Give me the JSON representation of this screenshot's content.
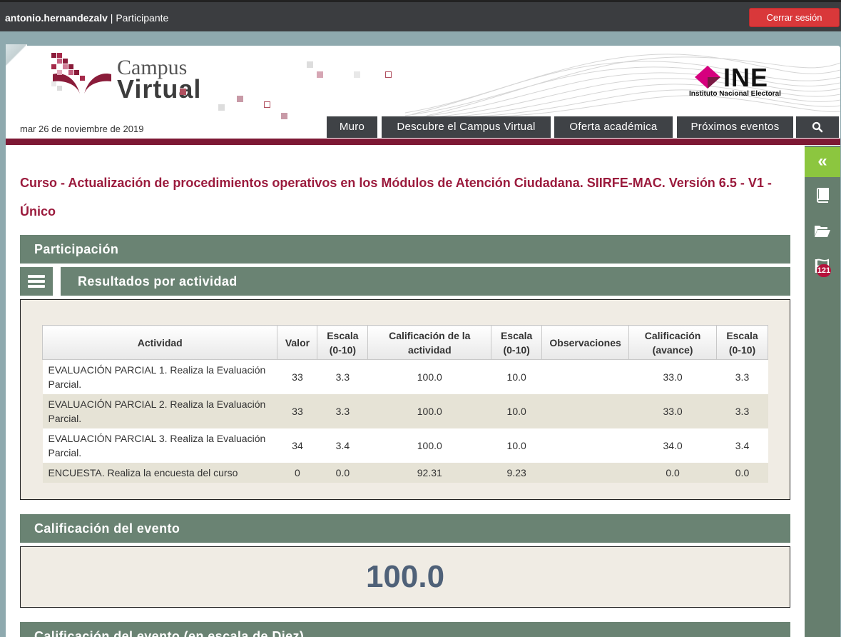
{
  "topbar": {
    "username": "antonio.hernandezalv",
    "separator": " | ",
    "role": "Participante",
    "logout_label": "Cerrar sesión"
  },
  "header": {
    "logo_line1": "Campus",
    "logo_line2": "Virtual",
    "ine_logo": "INE",
    "ine_subtitle": "Instituto Nacional Electoral",
    "date": "mar 26 de noviembre de 2019",
    "nav": [
      "Muro",
      "Descubre el Campus Virtual",
      "Oferta académica",
      "Próximos eventos"
    ],
    "search_icon": "search-icon"
  },
  "sidebar": {
    "toggle_label": "«",
    "icons": [
      "book-icon",
      "folder-open-icon",
      "flag-icon"
    ],
    "badge_count": "121"
  },
  "course": {
    "title": "Curso - Actualización de procedimientos operativos en los Módulos de Atención Ciudadana. SIIRFE-MAC. Versión 6.5 - V1 - Único"
  },
  "participation": {
    "heading": "Participación",
    "results_heading": "Resultados por actividad",
    "columns": [
      "Actividad",
      "Valor",
      "Escala (0-10)",
      "Calificación de la actividad",
      "Escala (0-10)",
      "Observaciones",
      "Calificación (avance)",
      "Escala (0-10)"
    ],
    "rows": [
      {
        "actividad": "EVALUACIÓN PARCIAL 1. Realiza la Evaluación Parcial.",
        "valor": "33",
        "escala1": "3.3",
        "calificacion": "100.0",
        "escala2": "10.0",
        "observaciones": "",
        "avance": "33.0",
        "escala3": "3.3"
      },
      {
        "actividad": "EVALUACIÓN PARCIAL 2. Realiza la Evaluación Parcial.",
        "valor": "33",
        "escala1": "3.3",
        "calificacion": "100.0",
        "escala2": "10.0",
        "observaciones": "",
        "avance": "33.0",
        "escala3": "3.3"
      },
      {
        "actividad": "EVALUACIÓN PARCIAL 3. Realiza la Evaluación Parcial.",
        "valor": "34",
        "escala1": "3.4",
        "calificacion": "100.0",
        "escala2": "10.0",
        "observaciones": "",
        "avance": "34.0",
        "escala3": "3.4"
      },
      {
        "actividad": "ENCUESTA. Realiza la encuesta del curso",
        "valor": "0",
        "escala1": "0.0",
        "calificacion": "92.31",
        "escala2": "9.23",
        "observaciones": "",
        "avance": "0.0",
        "escala3": "0.0"
      }
    ]
  },
  "event_grade": {
    "heading": "Calificación del evento",
    "value": "100.0"
  },
  "event_grade_ten": {
    "heading": "Calificación del evento (en escala de Diez)"
  },
  "colors": {
    "accent_red": "#9b1b3d",
    "section_green": "#6a8373",
    "sidebar_green": "#667e6e",
    "toggle_green": "#8cc63f",
    "logout_red": "#d9383a",
    "grade_blue": "#4f6178"
  }
}
